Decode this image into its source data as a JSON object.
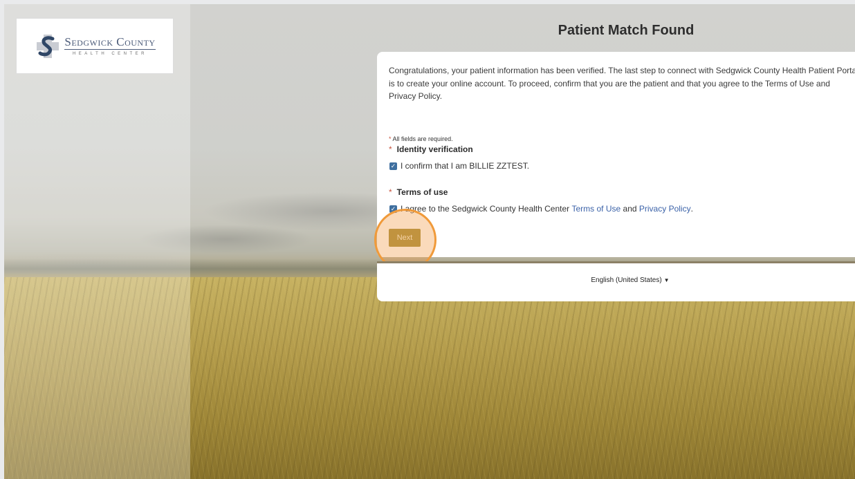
{
  "logo": {
    "title": "Sedgwick County",
    "subtitle": "HEALTH CENTER",
    "icon": "sedgwick-s-cross-logo"
  },
  "page": {
    "title": "Patient Match Found"
  },
  "card": {
    "intro": "Congratulations, your patient information has been verified. The last step to connect with Sedgwick County Health Patient Portal is to create your online account. To proceed, confirm that you are the patient and that you agree to the Terms of Use and Privacy Policy.",
    "required_star": "*",
    "required_note": "All fields are required.",
    "identity": {
      "heading": "Identity verification",
      "checkbox_label": "I confirm that I am BILLIE ZZTEST.",
      "checked": true
    },
    "terms": {
      "heading": "Terms of use",
      "label_prefix": "I agree to the Sedgwick County Health Center",
      "terms_link": "Terms of Use",
      "label_and": "and",
      "privacy_link": "Privacy Policy",
      "label_suffix": ".",
      "checked": true
    },
    "next_label": "Next"
  },
  "footer": {
    "language": "English (United States)"
  },
  "colors": {
    "next_button": "#a89341",
    "highlight": "#f09a3a",
    "link": "#3b62a8",
    "checkbox": "#3f6f9f",
    "required_star": "#c8533d"
  }
}
